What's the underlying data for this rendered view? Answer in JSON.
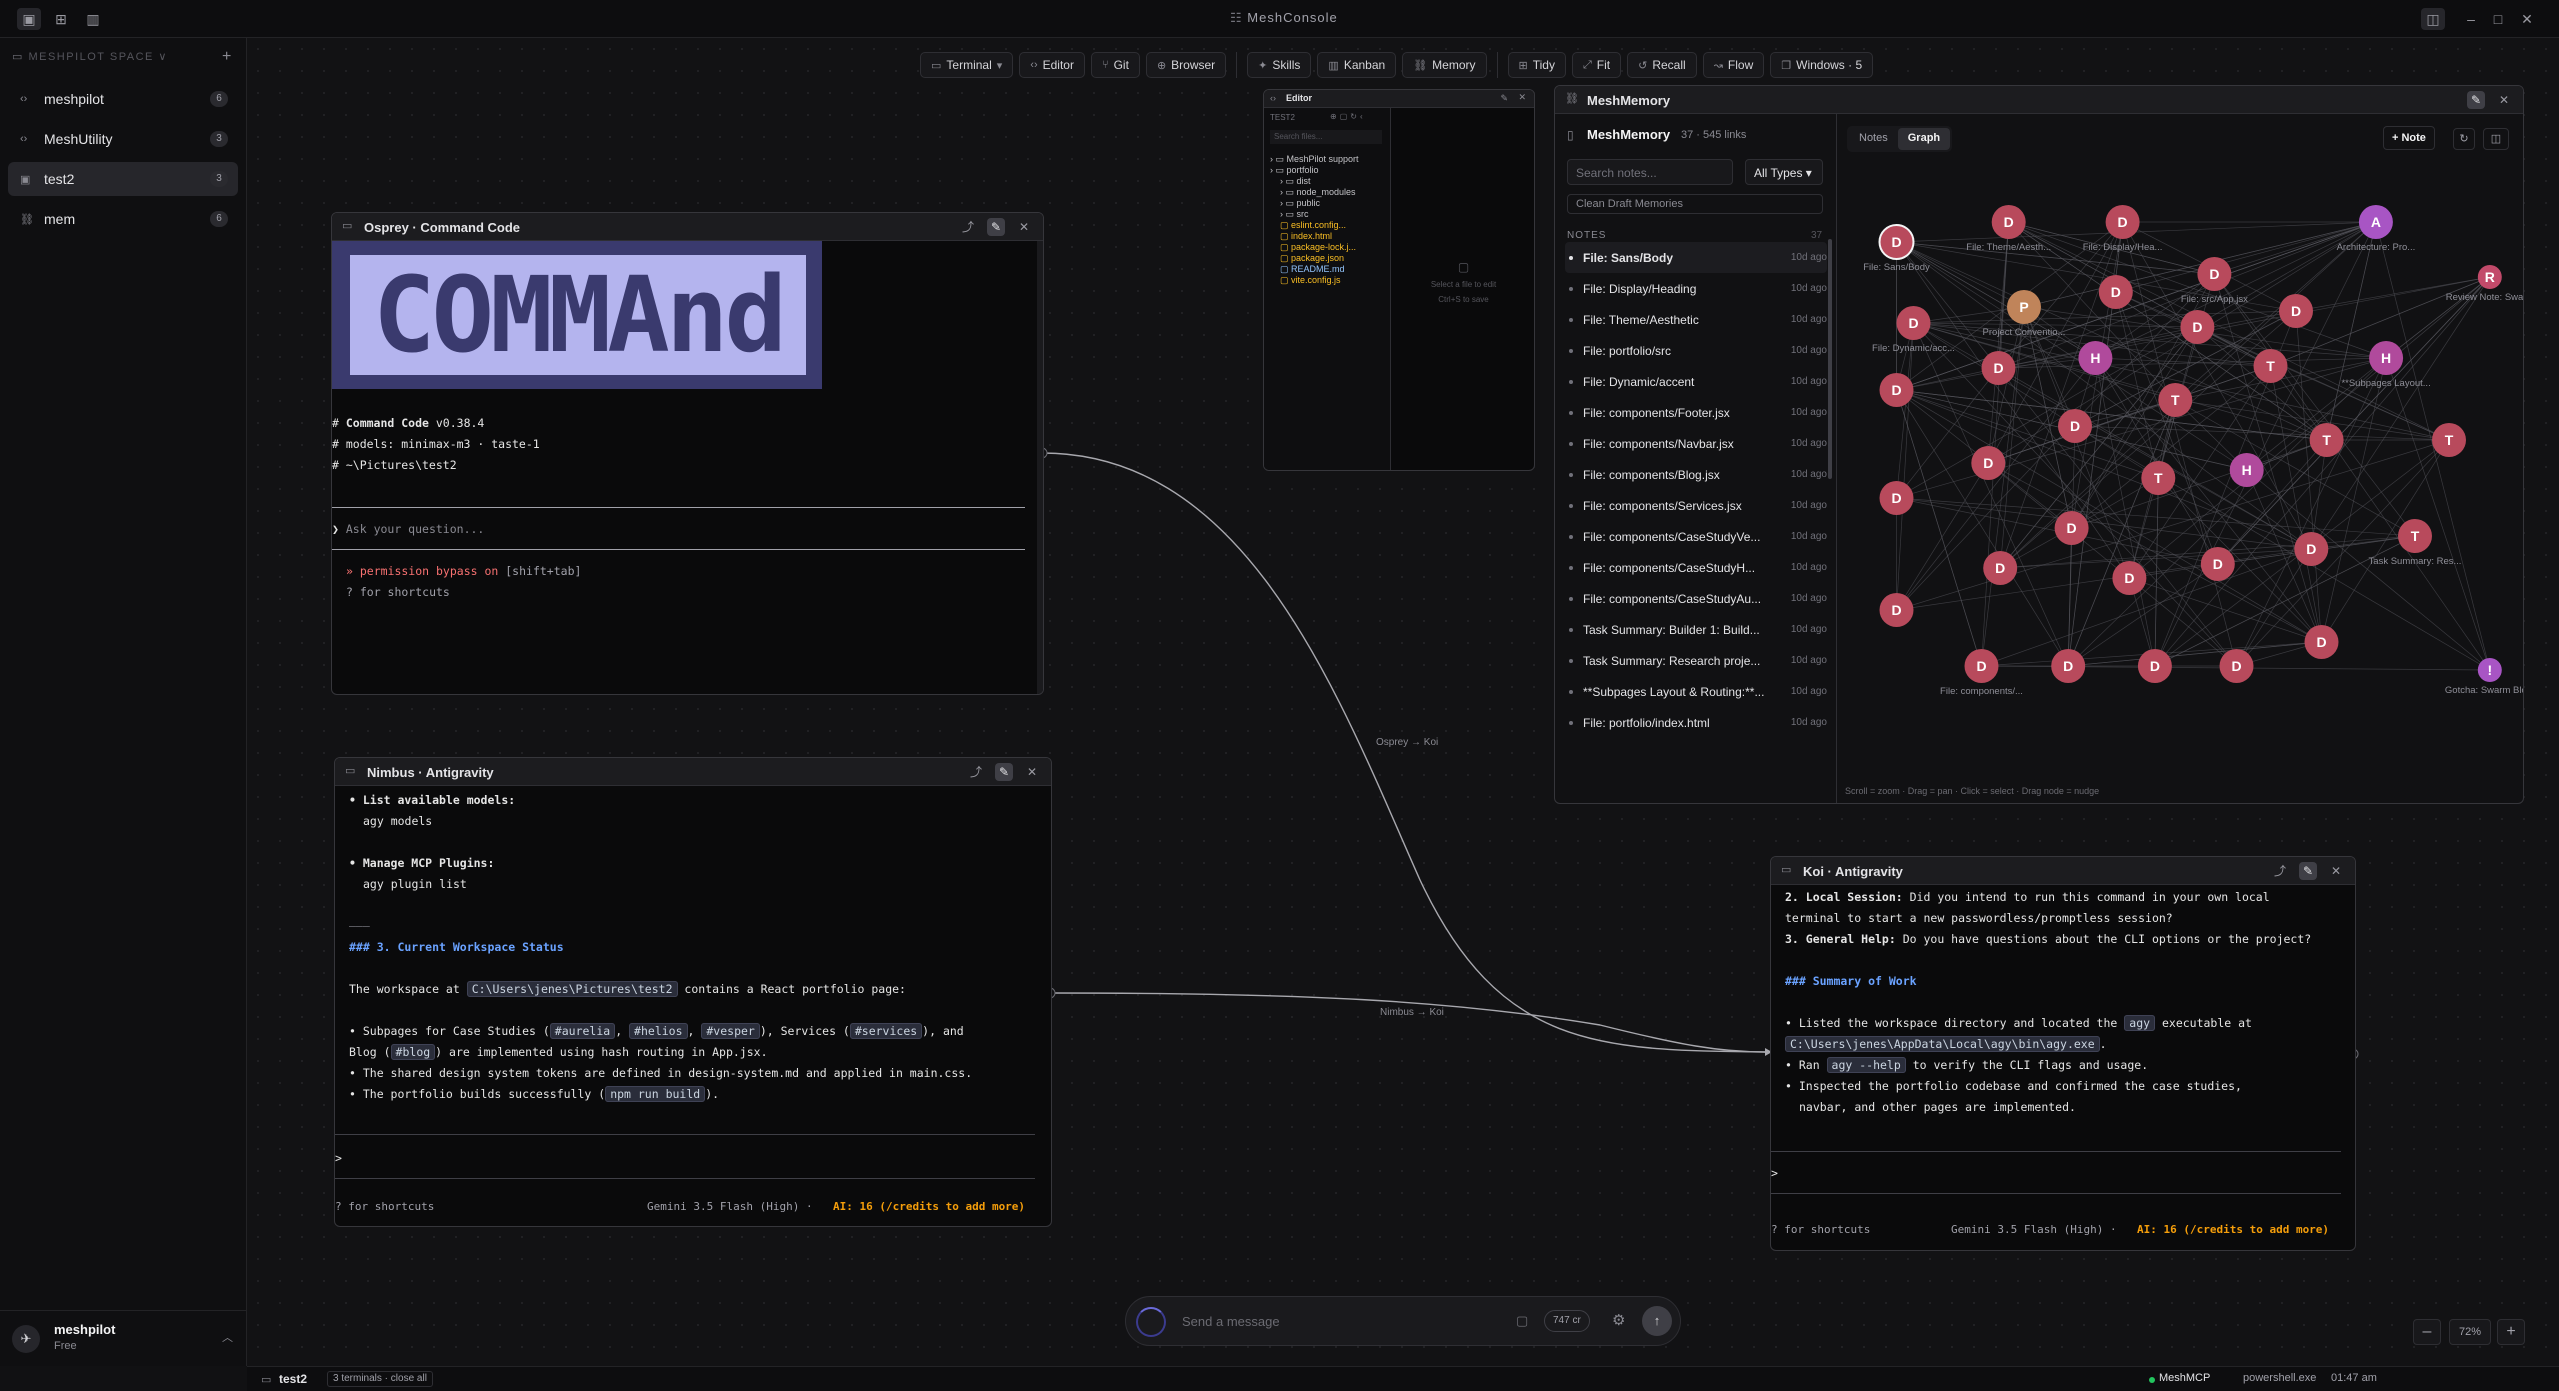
{
  "app": {
    "title": "MeshConsole"
  },
  "sidebar": {
    "header": "MESHPILOT SPACE ∨",
    "items": [
      {
        "label": "meshpilot",
        "count": "6"
      },
      {
        "label": "MeshUtility",
        "count": "3"
      },
      {
        "label": "test2",
        "count": "3"
      },
      {
        "label": "mem",
        "count": "6"
      }
    ],
    "user": {
      "name": "meshpilot",
      "plan": "Free"
    }
  },
  "toolbar": {
    "items": [
      "Terminal",
      "Editor",
      "Git",
      "Browser",
      "Skills",
      "Kanban",
      "Memory",
      "Tidy",
      "Fit",
      "Recall",
      "Flow",
      "Windows · 5"
    ]
  },
  "osprey": {
    "title": "Osprey · Command Code",
    "banner": "COMMAnd",
    "line1_prefix": "# ",
    "line1_bold": "Command Code",
    "line1_rest": " v0.38.4",
    "line2": "# models: minimax-m3 · taste-1",
    "line3": "# ~\\Pictures\\test2",
    "prompt_glyph": "❯",
    "placeholder": "Ask your question...",
    "perm": "» permission bypass on",
    "perm_hint": " [shift+tab]",
    "shortcuts": "? for shortcuts"
  },
  "nimbus": {
    "title": "Nimbus · Antigravity",
    "l1": "• List available models:",
    "l2": "agy models",
    "l3": "• Manage MCP Plugins:",
    "l4": "agy plugin list",
    "hr": "———",
    "heading": "### 3. Current Workspace Status",
    "p1a": "The workspace at ",
    "p1code": "C:\\Users\\jenes\\Pictures\\test2",
    "p1b": " contains a React portfolio page:",
    "b1a": "• Subpages for Case Studies (",
    "b1c1": "#aurelia",
    "b1s1": ", ",
    "b1c2": "#helios",
    "b1s2": ", ",
    "b1c3": "#vesper",
    "b1b": "), Services (",
    "b1c4": "#services",
    "b1e": "), and",
    "b1f": "Blog (",
    "b1c5": "#blog",
    "b1g": ") are implemented using hash routing in App.jsx.",
    "b2": "• The shared design system tokens are defined in design-system.md and applied in main.css.",
    "b3a": "• The portfolio builds successfully (",
    "b3c": "npm run build",
    "b3b": ").",
    "prompt": ">",
    "shortcuts": "? for shortcuts",
    "model": "Gemini 3.5 Flash (High) ·",
    "credits": "AI: 16 (/credits to add more)"
  },
  "koi": {
    "title": "Koi · Antigravity",
    "l1a": "2. Local Session:",
    "l1b": " Did you intend to run this command in your own local",
    "l2": "terminal to start a new passwordless/promptless session?",
    "l3a": "3. General Help:",
    "l3b": " Do you have questions about the CLI options or the project?",
    "heading": "### Summary of Work",
    "b1a": "• Listed the workspace directory and located the ",
    "b1c": "agy",
    "b1b": " executable at",
    "b1path": "C:\\Users\\jenes\\AppData\\Local\\agy\\bin\\agy.exe",
    "b1end": ".",
    "b2a": "• Ran ",
    "b2c": "agy --help",
    "b2b": " to verify the CLI flags and usage.",
    "b3": "• Inspected the portfolio codebase and confirmed the case studies,",
    "b4": "navbar, and other pages are implemented.",
    "prompt": ">",
    "shortcuts": "? for shortcuts",
    "model": "Gemini 3.5 Flash (High) ·",
    "credits": "AI: 16 (/credits to add more)"
  },
  "editor": {
    "title": "Editor",
    "section": "TEST2",
    "search_placeholder": "Search files...",
    "tree": [
      "MeshPilot support",
      "portfolio",
      "dist",
      "node_modules",
      "public",
      "src",
      "eslint.config...",
      "index.html",
      "package-lock.j...",
      "package.json",
      "README.md",
      "vite.config.js"
    ],
    "empty": "Select a file to edit",
    "empty_hint": "Ctrl+S to save"
  },
  "memory": {
    "title": "MeshMemory",
    "subtitle": "MeshMemory",
    "stats": "37 · 545 links",
    "tab_notes": "Notes",
    "tab_graph": "Graph",
    "note_btn": "+ Note",
    "search_placeholder": "Search notes...",
    "type_filter": "All Types",
    "clean_btn": "Clean Draft Memories",
    "notes_header": "NOTES",
    "notes_count": "37",
    "notes": [
      "File: Sans/Body",
      "File: Display/Heading",
      "File: Theme/Aesthetic",
      "File: portfolio/src",
      "File: Dynamic/accent",
      "File: components/Footer.jsx",
      "File: components/Navbar.jsx",
      "File: components/Blog.jsx",
      "File: components/Services.jsx",
      "File: components/CaseStudyVe...",
      "File: components/CaseStudyH...",
      "File: components/CaseStudyAu...",
      "Task Summary: Builder 1: Build...",
      "Task Summary: Research proje...",
      "**Subpages Layout & Routing:**...",
      "File: portfolio/index.html"
    ],
    "note_time": "10d ago",
    "graph_hint": "Scroll = zoom · Drag = pan · Click = select · Drag node = nudge",
    "graph_labels": {
      "n1": "File: Sans/Body",
      "n2": "File: Theme/Aesth...",
      "n3": "File: Display/Hea...",
      "n4": "Architecture: Pro...",
      "n5": "Review Note: Swar...",
      "n6": "Project Conventio...",
      "n7": "File: src/App.jsx",
      "n8": "File: Dynamic/acc...",
      "n9": "Gotcha: Swarm Blo...",
      "n10": "Task Summary: Res...",
      "n11": "File: components/...",
      "n12": "**Subpages Layout..."
    }
  },
  "connections": {
    "a": "Osprey → Koi",
    "b": "Nimbus → Koi"
  },
  "composer": {
    "placeholder": "Send a message",
    "credits": "747 cr"
  },
  "zoom": {
    "level": "72%"
  },
  "status": {
    "workspace": "test2",
    "terms": "3 terminals · close all",
    "mcp": "MeshMCP",
    "shell": "powershell.exe",
    "time": "01:47 am"
  }
}
